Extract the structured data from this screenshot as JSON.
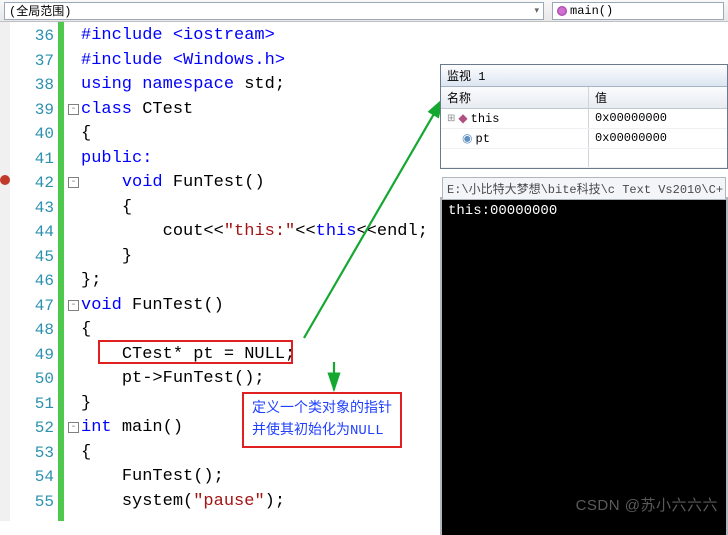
{
  "topbar": {
    "scope_label": "(全局范围)",
    "function_label": "main()"
  },
  "lines": {
    "start": 36,
    "end": 55
  },
  "code": {
    "l36": "#include <iostream>",
    "l37": "#include <Windows.h>",
    "l38_a": "using namespace ",
    "l38_b": "std;",
    "l39_a": "class ",
    "l39_b": "CTest",
    "l40": "{",
    "l41": "public:",
    "l42_a": "void ",
    "l42_b": "FunTest()",
    "l43": "{",
    "l44_a": "cout<<",
    "l44_b": "\"this:\"",
    "l44_c": "<<",
    "l44_d": "this",
    "l44_e": "<<endl;",
    "l45": "}",
    "l46": "};",
    "l47_a": "void ",
    "l47_b": "FunTest()",
    "l48": "{",
    "l49_a": "CTest* pt = NULL;",
    "l50": "pt->FunTest();",
    "l51": "}",
    "l52_a": "int ",
    "l52_b": "main()",
    "l53": "{",
    "l54": "FunTest();",
    "l55_a": "system(",
    "l55_b": "\"pause\"",
    "l55_c": ");"
  },
  "annotation": {
    "line1": "定义一个类对象的指针",
    "line2": "并使其初始化为NULL"
  },
  "watch": {
    "title": "监视 1",
    "hdr_name": "名称",
    "hdr_value": "值",
    "rows": [
      {
        "name": "this",
        "value": "0x00000000",
        "expand": "+"
      },
      {
        "name": "pt",
        "value": "0x00000000",
        "expand": ""
      }
    ]
  },
  "console": {
    "title": "E:\\小比特大梦想\\bite科技\\c Text Vs2010\\C+",
    "output": "this:00000000"
  },
  "watermark": "CSDN @苏小六六六"
}
